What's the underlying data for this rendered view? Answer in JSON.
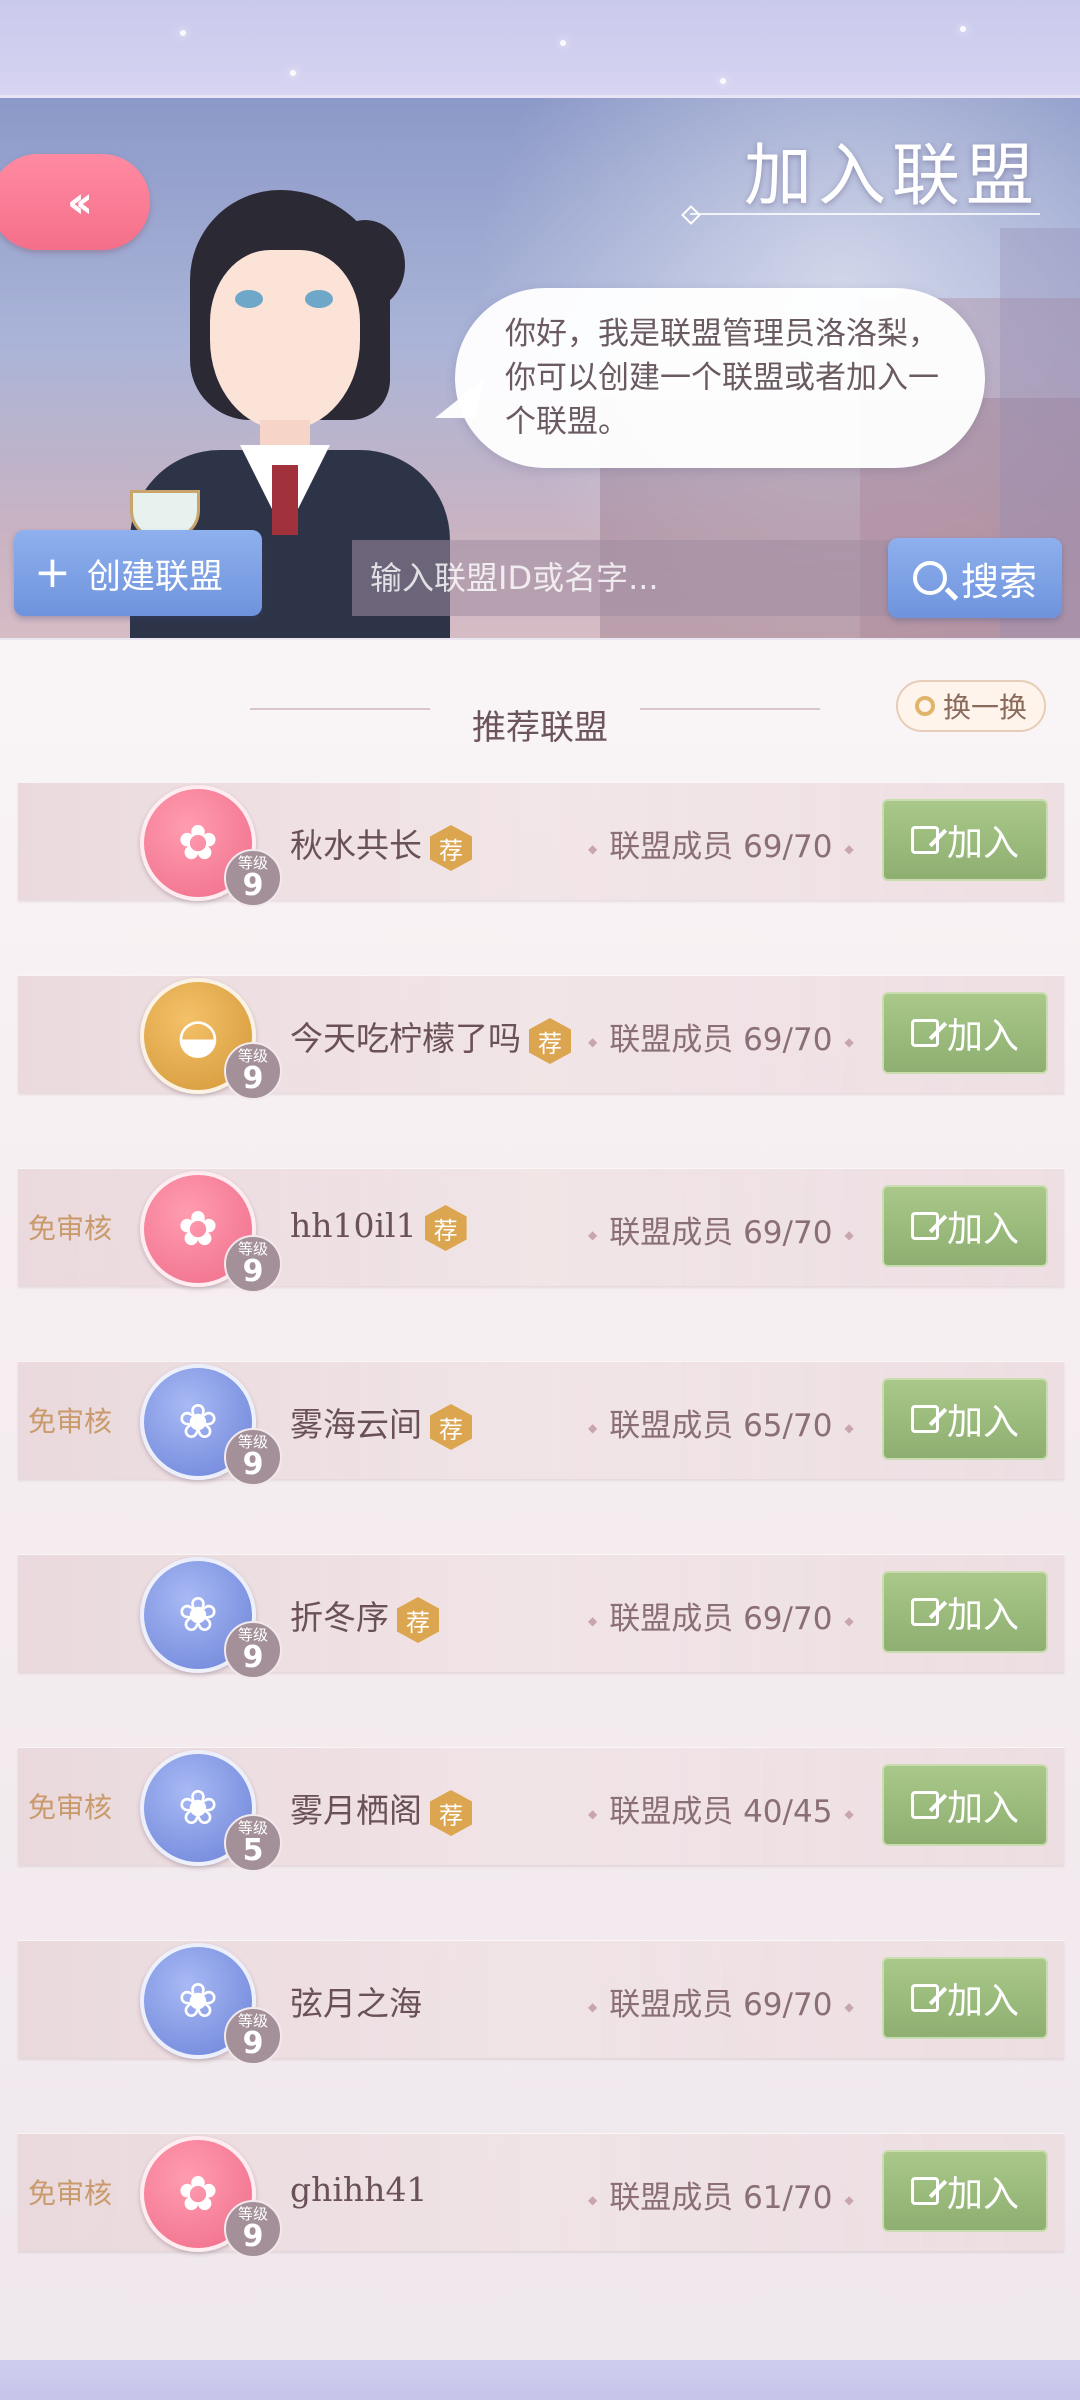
{
  "header": {
    "title": "加入联盟",
    "back_icon": "double-chevron-left-icon"
  },
  "npc": {
    "dialog": "你好，我是联盟管理员洛洛梨，你可以创建一个联盟或者加入一个联盟。"
  },
  "toolbar": {
    "create_label": "创建联盟",
    "search_placeholder": "输入联盟ID或名字...",
    "search_label": "搜索"
  },
  "recommended": {
    "title": "推荐联盟",
    "refresh_label": "换一换",
    "level_label": "等级",
    "rec_badge": "荐",
    "join_label": "加入",
    "no_review_label": "免审核",
    "members_prefix": "联盟成员",
    "items": [
      {
        "name": "秋水共长",
        "emblem": "fan-icon",
        "color": "pink",
        "level": "9",
        "members": "联盟成员 69/70",
        "recommended": true,
        "no_review": false
      },
      {
        "name": "今天吃柠檬了吗",
        "emblem": "food-bowl-icon",
        "color": "gold",
        "level": "9",
        "members": "联盟成员 69/70",
        "recommended": true,
        "no_review": false
      },
      {
        "name": "hh10il1",
        "emblem": "fan-icon",
        "color": "pink",
        "level": "9",
        "members": "联盟成员 69/70",
        "recommended": true,
        "no_review": true
      },
      {
        "name": "雾海云间",
        "emblem": "moon-rose-icon",
        "color": "blue",
        "level": "9",
        "members": "联盟成员 65/70",
        "recommended": true,
        "no_review": true
      },
      {
        "name": "折冬序",
        "emblem": "moon-rose-icon",
        "color": "blue",
        "level": "9",
        "members": "联盟成员 69/70",
        "recommended": true,
        "no_review": false
      },
      {
        "name": "雾月栖阁",
        "emblem": "moon-rose-icon",
        "color": "blue",
        "level": "5",
        "members": "联盟成员 40/45",
        "recommended": true,
        "no_review": true
      },
      {
        "name": "弦月之海",
        "emblem": "moon-rose-icon",
        "color": "blue",
        "level": "9",
        "members": "联盟成员 69/70",
        "recommended": false,
        "no_review": false
      },
      {
        "name": "ghihh41",
        "emblem": "fan-icon",
        "color": "pink",
        "level": "9",
        "members": "联盟成员 61/70",
        "recommended": false,
        "no_review": true
      }
    ]
  },
  "colors": {
    "accent_blue": "#7a9be2",
    "join_green": "#9bbb7e",
    "back_pink": "#f77b95",
    "rec_gold": "#dca54f"
  }
}
